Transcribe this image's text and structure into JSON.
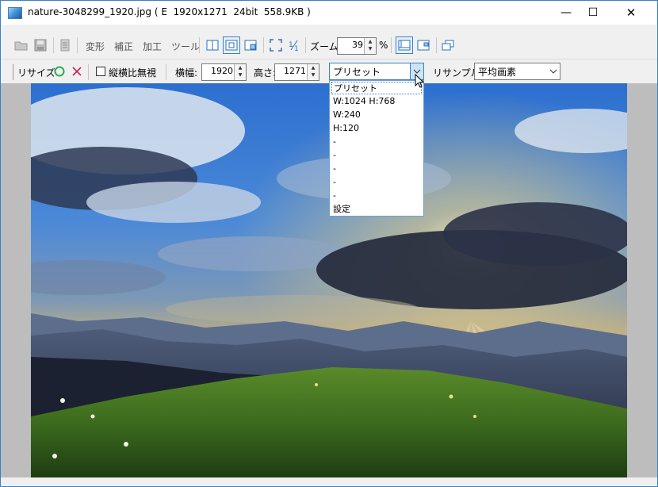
{
  "window": {
    "title": "nature-3048299_1920.jpg ( E  1920x1271  24bit  558.9KB )",
    "minimize_glyph": "—",
    "maximize_glyph": "☐",
    "close_glyph": "✕"
  },
  "toolbar": {
    "menus": [
      "変形",
      "補正",
      "加工",
      "ツール"
    ],
    "zoom_label": "ズーム:",
    "zoom_value": "39",
    "zoom_unit": "%"
  },
  "resize_bar": {
    "title": "リサイズ",
    "ignore_ratio_label": "縦横比無視",
    "ignore_ratio_checked": false,
    "width_label": "横幅:",
    "width_value": "1920",
    "height_label": "高さ:",
    "height_value": "1271",
    "preset_value": "プリセット",
    "resample_label": "リサンプル:",
    "resample_value": "平均画素"
  },
  "preset_dropdown": {
    "items": [
      "プリセット",
      "W:1024 H:768",
      "W:240",
      "H:120",
      "-",
      "-",
      "-",
      "-",
      "-",
      "設定"
    ],
    "selected_index": 0
  },
  "colors": {
    "accent": "#3c7fc5",
    "ok": "#2fae4e",
    "cancel": "#c0285a"
  }
}
